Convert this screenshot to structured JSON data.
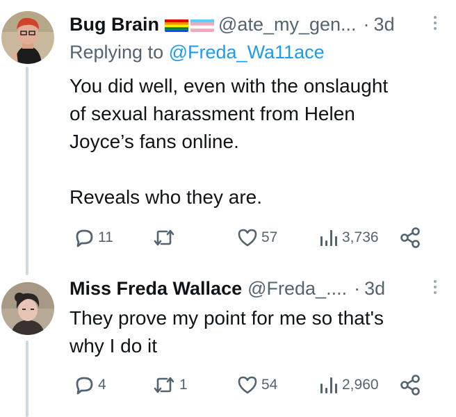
{
  "tweets": [
    {
      "display_name": "Bug Brain",
      "flags": [
        "rainbow-flag",
        "transgender-flag"
      ],
      "handle": "@ate_my_gen...",
      "separator": "·",
      "time": "3d",
      "reply_label": "Replying to",
      "reply_mention": "@Freda_Wa11ace",
      "text": "You did well, even with the onslaught\nof sexual harassment from Helen\nJoyce’s fans online.\n\nReveals who they are.",
      "actions": {
        "replies": "11",
        "retweets": "",
        "likes": "57",
        "views": "3,736"
      }
    },
    {
      "display_name": "Miss Freda Wallace",
      "handle": "@Freda_....",
      "separator": "·",
      "time": "3d",
      "text": "They prove my point for me so that's\nwhy I do it",
      "actions": {
        "replies": "4",
        "retweets": "1",
        "likes": "54",
        "views": "2,960"
      }
    }
  ],
  "colors": {
    "text": "#0f1419",
    "secondary": "#536471",
    "link": "#1d9bf0",
    "thread_line": "#cfd9de"
  }
}
